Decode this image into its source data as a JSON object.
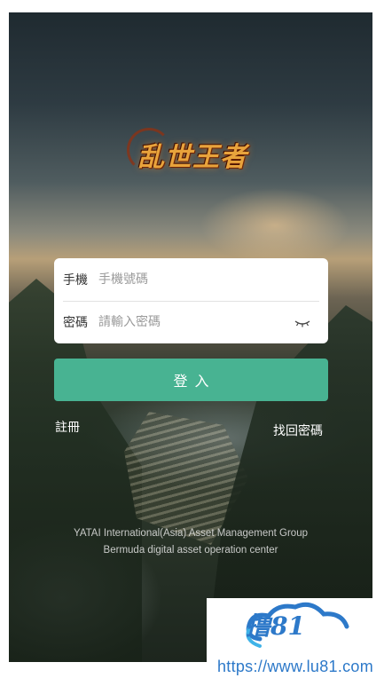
{
  "logo": {
    "text": "乱世王者"
  },
  "form": {
    "phone": {
      "label": "手機",
      "placeholder": "手機號碼",
      "value": ""
    },
    "password": {
      "label": "密碼",
      "placeholder": "請輸入密碼",
      "value": ""
    },
    "password_toggle_icon": "eye-closed-icon"
  },
  "actions": {
    "login_label": "登入",
    "register_label": "註冊",
    "forgot_label": "找回密碼"
  },
  "footer": {
    "line1": "YATAI International(Asia) Asset Management Group",
    "line2": "Bermuda digital asset operation center"
  },
  "watermark": {
    "text": "撸81",
    "url": "https://www.lu81.com"
  },
  "colors": {
    "button": "#48b392",
    "watermark": "#2d79c9"
  }
}
